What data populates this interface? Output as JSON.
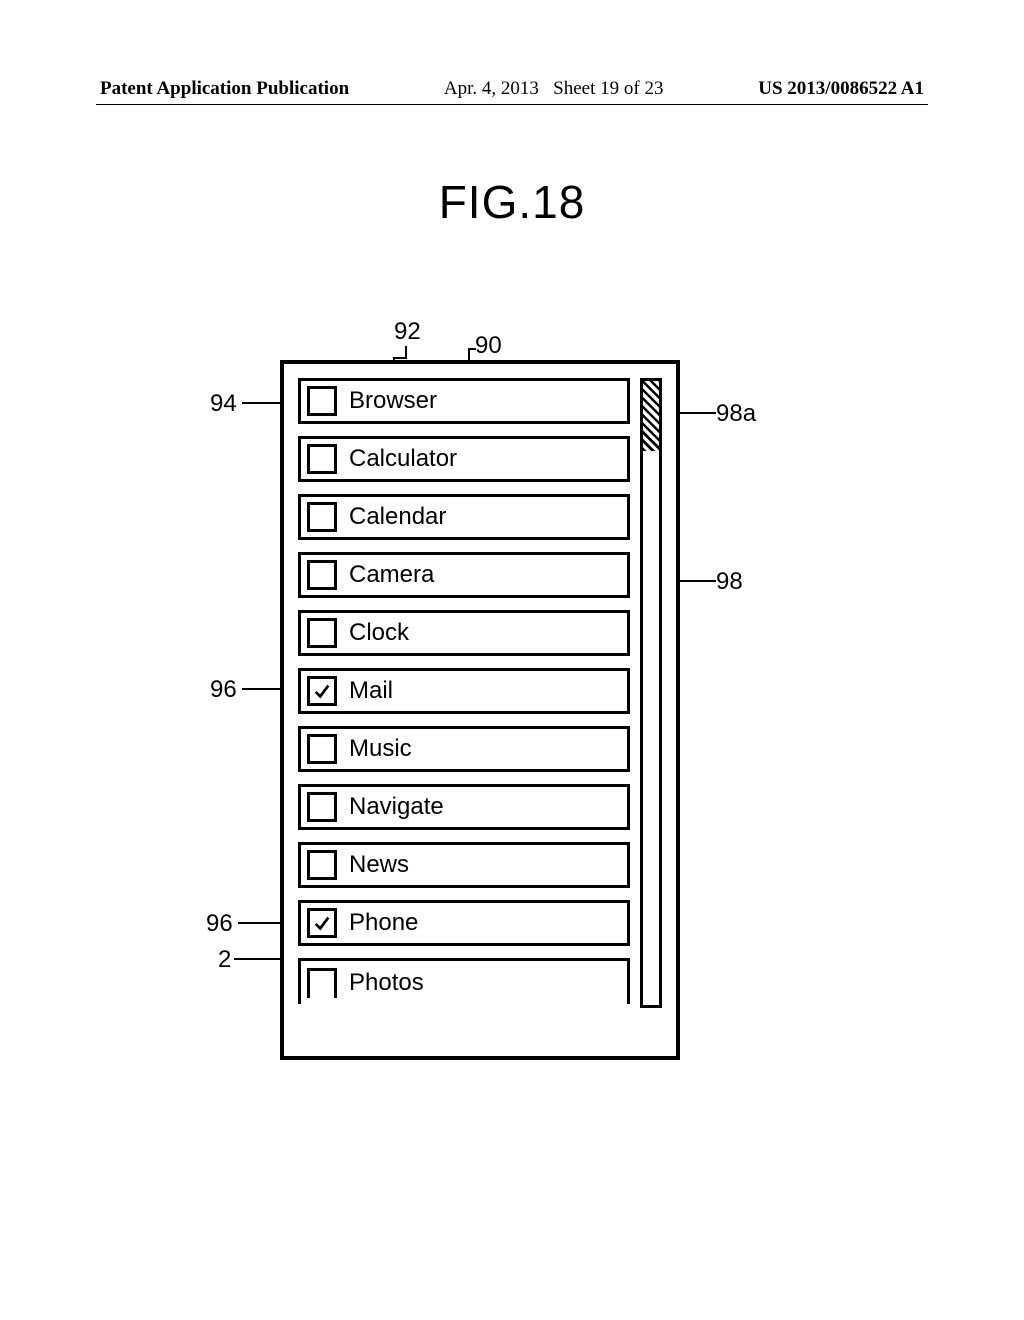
{
  "header": {
    "pubtype": "Patent Application Publication",
    "date": "Apr. 4, 2013",
    "sheet": "Sheet 19 of 23",
    "pubnum": "US 2013/0086522 A1"
  },
  "figure": {
    "title": "FIG.18"
  },
  "list": {
    "items": [
      {
        "label": "Browser",
        "checked": false
      },
      {
        "label": "Calculator",
        "checked": false
      },
      {
        "label": "Calendar",
        "checked": false
      },
      {
        "label": "Camera",
        "checked": false
      },
      {
        "label": "Clock",
        "checked": false
      },
      {
        "label": "Mail",
        "checked": true
      },
      {
        "label": "Music",
        "checked": false
      },
      {
        "label": "Navigate",
        "checked": false
      },
      {
        "label": "News",
        "checked": false
      },
      {
        "label": "Phone",
        "checked": true
      },
      {
        "label": "Photos",
        "checked": false
      }
    ]
  },
  "refs": {
    "r90": "90",
    "r92": "92",
    "r94": "94",
    "r96a": "96",
    "r96b": "96",
    "r2": "2",
    "r98": "98",
    "r98a": "98a"
  }
}
